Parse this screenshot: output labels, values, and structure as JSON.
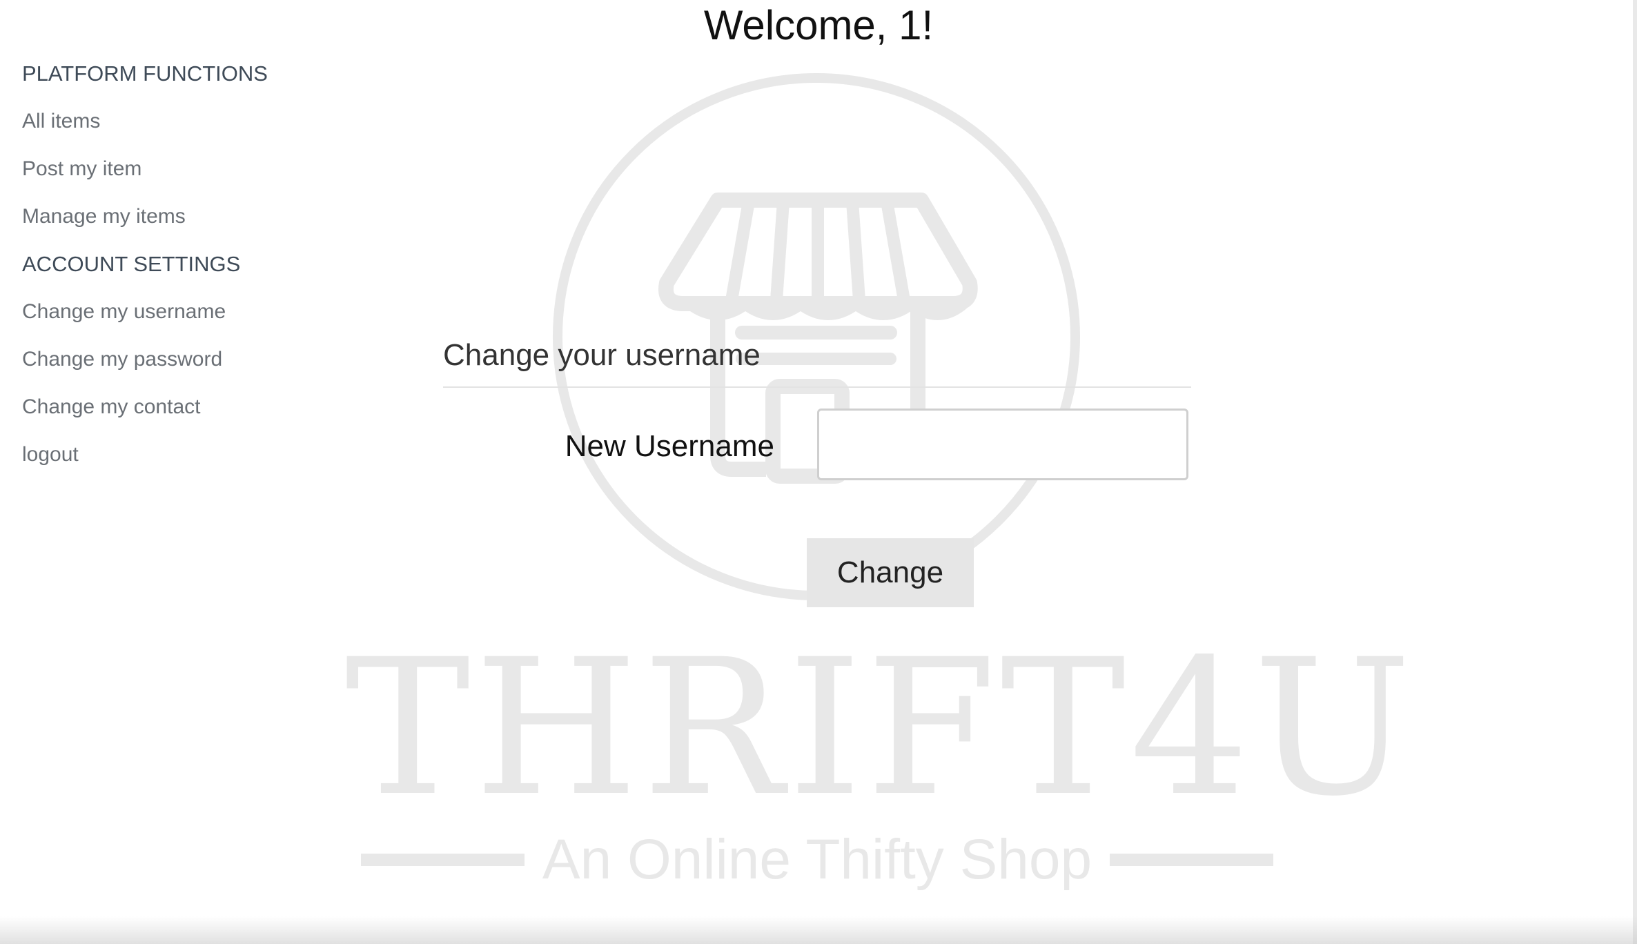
{
  "header": {
    "welcome": "Welcome, 1!"
  },
  "sidebar": {
    "sections": [
      {
        "heading": "PLATFORM FUNCTIONS",
        "items": [
          "All items",
          "Post my item",
          "Manage my items"
        ]
      },
      {
        "heading": "ACCOUNT SETTINGS",
        "items": [
          "Change my username",
          "Change my password",
          "Change my contact",
          "logout"
        ]
      }
    ]
  },
  "form": {
    "title": "Change your username",
    "field_label": "New Username",
    "field_value": "",
    "field_placeholder": "",
    "submit_label": "Change"
  },
  "watermark": {
    "brand": "THRIFT4U",
    "tagline": "An Online Thifty Shop",
    "icon": "storefront-icon",
    "color": "#e8e8e8"
  },
  "colors": {
    "sidebar_heading": "#3e4a57",
    "sidebar_link": "#6a6f75",
    "button_bg": "#e6e6e6"
  }
}
